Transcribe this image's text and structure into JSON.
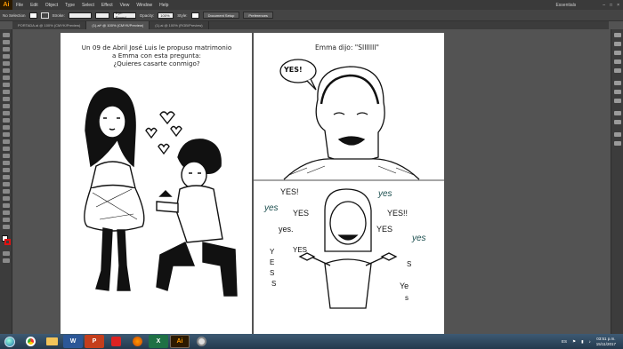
{
  "app": {
    "logo": "Ai"
  },
  "menu": [
    "File",
    "Edit",
    "Object",
    "Type",
    "Select",
    "Effect",
    "View",
    "Window",
    "Help"
  ],
  "workspace": "Essentials",
  "control_bar": {
    "selection": "No Selection",
    "stroke_label": "Stroke:",
    "brush": "5 pt. Round",
    "opacity_label": "Opacity:",
    "opacity_value": "100%",
    "style_label": "Style:",
    "document_setup": "Document Setup",
    "preferences": "Preferences"
  },
  "tabs": [
    "PORTADA.ai @ 100% (CMYK/Preview)",
    "(1).ai* @ 100% (CMYK/Preview)",
    "(1).ai @ 100% (RGB/Preview)"
  ],
  "story": {
    "left_text": [
      "Un 09 de Abril José Luis le propuso matrimonio",
      "a Emma con esta pregunta:",
      "¿Quieres casarte conmigo?"
    ],
    "right_title": "Emma dijo: \"SIIIIIII\"",
    "speech_bubble": "YES!",
    "doodles": [
      "YES!",
      "yes",
      "yes",
      "YES",
      "YES!!",
      "yes.",
      "YES",
      "yes",
      "YES",
      "Y",
      "E",
      "S",
      "S",
      "Ye",
      "s",
      "S"
    ]
  },
  "taskbar": {
    "apps": [
      "chrome-icon",
      "folder-icon",
      "word-icon",
      "powerpoint-icon",
      "acrobat-icon",
      "firefox-icon",
      "excel-icon",
      "illustrator-icon",
      "photos-icon"
    ],
    "word_letter": "W",
    "ppt_letter": "P",
    "excel_letter": "X",
    "ai_letter": "Ai",
    "lang": "ES",
    "time": "03:51 p.m.",
    "date": "15/11/2017"
  },
  "colors": {
    "app_bg": "#535353",
    "panel": "#3c3c3c",
    "ai_orange": "#ff9a00"
  }
}
